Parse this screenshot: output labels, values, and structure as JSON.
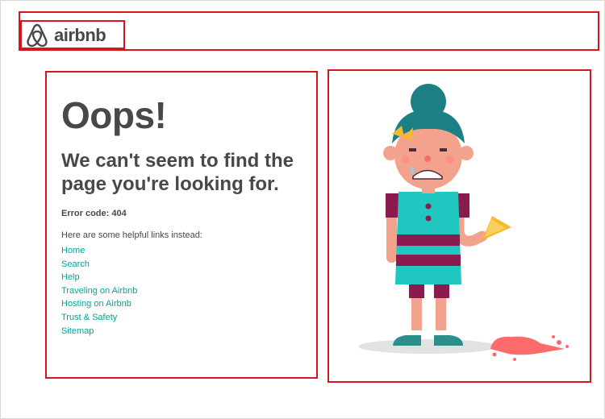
{
  "header": {
    "logo_text": "airbnb",
    "logo_icon": "airbnb-belo-icon",
    "brand_color": "#ff5a5f"
  },
  "main": {
    "title": "Oops!",
    "subtitle": "We can't seem to find the page you're looking for.",
    "error_code": "Error code: 404",
    "links_intro": "Here are some helpful links instead:",
    "links": [
      {
        "label": "Home"
      },
      {
        "label": "Search"
      },
      {
        "label": "Help"
      },
      {
        "label": "Traveling on Airbnb"
      },
      {
        "label": "Hosting on Airbnb"
      },
      {
        "label": "Trust & Safety"
      },
      {
        "label": "Sitemap"
      }
    ],
    "link_color": "#00a699"
  },
  "illustration": {
    "subject": "crying-girl-with-dropped-ice-cream-icon"
  }
}
